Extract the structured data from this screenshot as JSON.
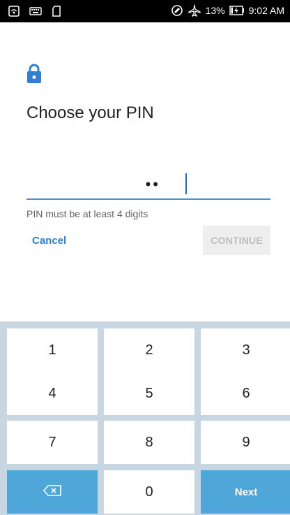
{
  "status_bar": {
    "battery": "13%",
    "time": "9:02 AM",
    "icons": [
      "hotspot-icon",
      "keyboard-icon",
      "sd-card-icon",
      "sync-icon",
      "airplane-icon",
      "battery-charging-icon"
    ]
  },
  "screen": {
    "title": "Choose your PIN",
    "pin_masked": "••",
    "hint": "PIN must be at least 4 digits",
    "cancel_label": "Cancel",
    "continue_label": "CONTINUE"
  },
  "keypad": {
    "keys": [
      "1",
      "2",
      "3",
      "4",
      "5",
      "6",
      "7",
      "8",
      "9",
      "0"
    ],
    "next_label": "Next"
  },
  "colors": {
    "accent": "#2f7fd5",
    "keypad_bg": "#c7d6e0",
    "action_key": "#4ea7d8"
  }
}
